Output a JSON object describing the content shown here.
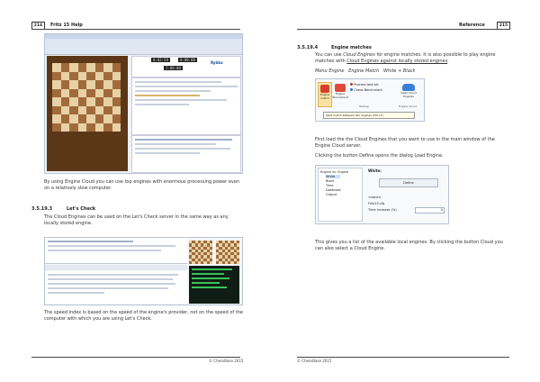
{
  "left": {
    "page_number": "214",
    "header_title": "Fritz 15 Help",
    "caption": "By using Engine Cloud you can use top engines with enormous processing power even on a relatively slow computer.",
    "section_number": "3.5.19.3",
    "section_title": "Let's Check",
    "intro": "The Cloud Engines can be used on the Let's Check server in the same way as any locally stored engine.",
    "body": "The speed index is based on the speed of the engine's provider, not on the speed of the computer with which you are using Let's Check.",
    "footer": "© ChessBase 2015",
    "shot1": {
      "clock1": "0:02:58",
      "clock2": "0:00:00",
      "clock3": "2:08:00",
      "engine": "Rybka"
    }
  },
  "right": {
    "page_number": "215",
    "header_title": "Reference",
    "section_number": "3.5.19.4",
    "section_title": "Engine matches",
    "intro_pre": "You can use",
    "intro_link": "Cloud Engines",
    "intro_mid": "for engine matches. It is also possible to play engine matches with",
    "intro_link2": "Cloud Engines against locally stored engines",
    "intro_end": ".",
    "path": "Menu Engine   Engine Match   White + Black",
    "ribbon": {
      "btn1": "Engine match",
      "btn2": "Engine Tournament",
      "item1": "Process test set",
      "item2": "Chess Benchmark",
      "group1": "Testing",
      "btn3": "Open Cloud Engines",
      "group2": "Engine Cloud",
      "tooltip": "Start match between two engines (Ctrl+F)"
    },
    "para1": "First load the the Cloud Engines that you want to use in the main window of the Engine Cloud server.",
    "para2": "Clicking the button Define opens the dialog Load Engine.",
    "dialog": {
      "tree_root": "Engine vs. Engine",
      "tree_items": [
        "White",
        "Black",
        "Time",
        "Database",
        "Output"
      ],
      "label_white": "White:",
      "define_button": "Define",
      "value1": "<none>",
      "value2": "Fritz15.cfg",
      "time_label": "Time increase (%)",
      "time_value": "0"
    },
    "para3": "This gives you a list of the available local engines. By clicking the button Cloud you can also select a Cloud Engine.",
    "footer": "© ChessBase 2015"
  }
}
